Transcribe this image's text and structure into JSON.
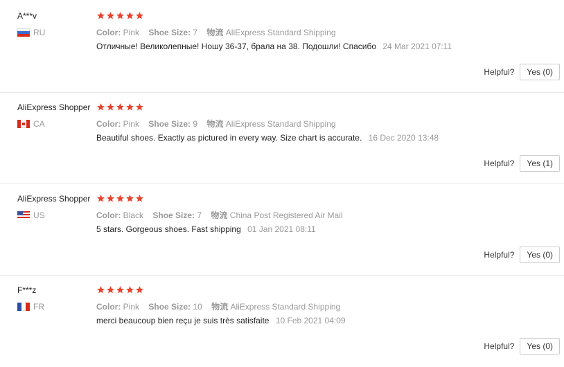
{
  "reviews": [
    {
      "user": "A***v",
      "country": "RU",
      "rating": 5,
      "color_key": "Color:",
      "color_val": "Pink",
      "size_key": "Shoe Size:",
      "size_val": "7",
      "ship_key": "物流",
      "ship_val": "AliExpress Standard Shipping",
      "text": "Отличные! Великолепные! Ношу 36-37, брала на 38. Подошли! Спасибо",
      "date": "24 Mar 2021 07:11",
      "helpful_label": "Helpful?",
      "yes": "Yes (0)"
    },
    {
      "user": "AliExpress Shopper",
      "country": "CA",
      "rating": 5,
      "color_key": "Color:",
      "color_val": "Pink",
      "size_key": "Shoe Size:",
      "size_val": "9",
      "ship_key": "物流",
      "ship_val": "AliExpress Standard Shipping",
      "text": "Beautiful shoes. Exactly as pictured in every way. Size chart is accurate.",
      "date": "16 Dec 2020 13:48",
      "helpful_label": "Helpful?",
      "yes": "Yes (1)"
    },
    {
      "user": "AliExpress Shopper",
      "country": "US",
      "rating": 5,
      "color_key": "Color:",
      "color_val": "Black",
      "size_key": "Shoe Size:",
      "size_val": "7",
      "ship_key": "物流",
      "ship_val": "China Post Registered Air Mail",
      "text": "5 stars. Gorgeous shoes. Fast shipping",
      "date": "01 Jan 2021 08:11",
      "helpful_label": "Helpful?",
      "yes": "Yes (0)"
    },
    {
      "user": "F***z",
      "country": "FR",
      "rating": 5,
      "color_key": "Color:",
      "color_val": "Pink",
      "size_key": "Shoe Size:",
      "size_val": "10",
      "ship_key": "物流",
      "ship_val": "AliExpress Standard Shipping",
      "text": "merci beaucoup bien reçu je suis très satisfaite",
      "date": "10 Feb 2021 04:09",
      "helpful_label": "Helpful?",
      "yes": "Yes (0)"
    }
  ],
  "colors": {
    "star": "#e8432e",
    "text": "#222222",
    "muted": "#999999"
  }
}
